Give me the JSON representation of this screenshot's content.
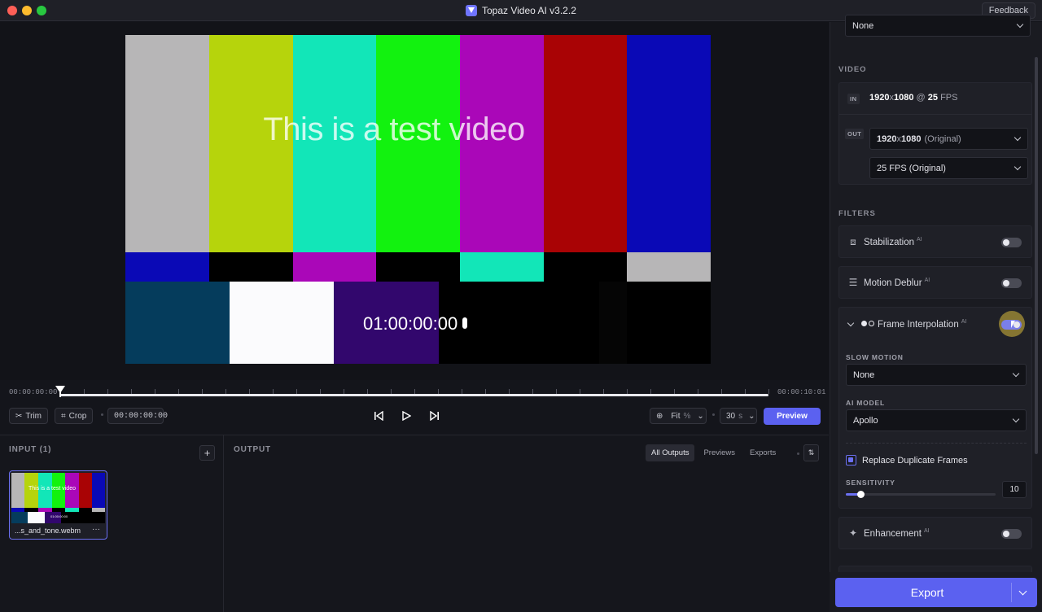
{
  "window": {
    "title": "Topaz Video AI  v3.2.2",
    "feedback_label": "Feedback"
  },
  "viewer": {
    "video_text": "This is a test video",
    "video_timecode": "01:00:00:00"
  },
  "timeline": {
    "start_time": "00:00:00:00",
    "end_time": "00:00:10:01",
    "playhead_fraction": 0
  },
  "controls": {
    "trim_label": "Trim",
    "crop_label": "Crop",
    "timecode": "00:00:00:00",
    "zoom_label": "Fit",
    "zoom_unit": "%",
    "fps_value": "30",
    "fps_unit": "s",
    "preview_label": "Preview"
  },
  "input_panel": {
    "label": "INPUT (1)",
    "add_symbol": "+",
    "file_name": "...s_and_tone.webm",
    "thumb_text": "This is a test video",
    "thumb_tc": "01:00:00:00",
    "more_symbol": "···"
  },
  "output_panel": {
    "label": "OUTPUT",
    "tabs": [
      "All Outputs",
      "Previews",
      "Exports"
    ],
    "active_tab": "All Outputs",
    "sort_symbol": "⇅"
  },
  "sidebar": {
    "top_select": "None",
    "video_section": "VIDEO",
    "in_tag": "IN",
    "in_resolution_w": "1920",
    "in_resolution_x": "x",
    "in_resolution_h": "1080",
    "in_at": "@",
    "in_fps": "25",
    "in_fps_unit": "FPS",
    "out_tag": "OUT",
    "out_resolution_w": "1920",
    "out_resolution_x": "x",
    "out_resolution_h": "1080",
    "out_resolution_note": "(Original)",
    "out_fps": "25 FPS (Original)",
    "filters_section": "FILTERS",
    "filters": [
      {
        "label": "Stabilization",
        "ai": "AI",
        "enabled": false
      },
      {
        "label": "Motion Deblur",
        "ai": "AI",
        "enabled": false
      },
      {
        "label": "Frame Interpolation",
        "ai": "AI",
        "enabled": true
      },
      {
        "label": "Enhancement",
        "ai": "AI",
        "enabled": false
      }
    ],
    "frame_interpolation": {
      "slow_motion_label": "SLOW MOTION",
      "slow_motion_value": "None",
      "ai_model_label": "AI MODEL",
      "ai_model_value": "Apollo",
      "replace_duplicates_label": "Replace Duplicate Frames",
      "replace_duplicates_checked": true,
      "sensitivity_label": "SENSITIVITY",
      "sensitivity_value": "10",
      "sensitivity_fraction": 0.1
    },
    "export_label": "Export"
  },
  "colors": {
    "accent": "#5b61f0",
    "background": "#14151b",
    "panel": "#1f2027"
  }
}
